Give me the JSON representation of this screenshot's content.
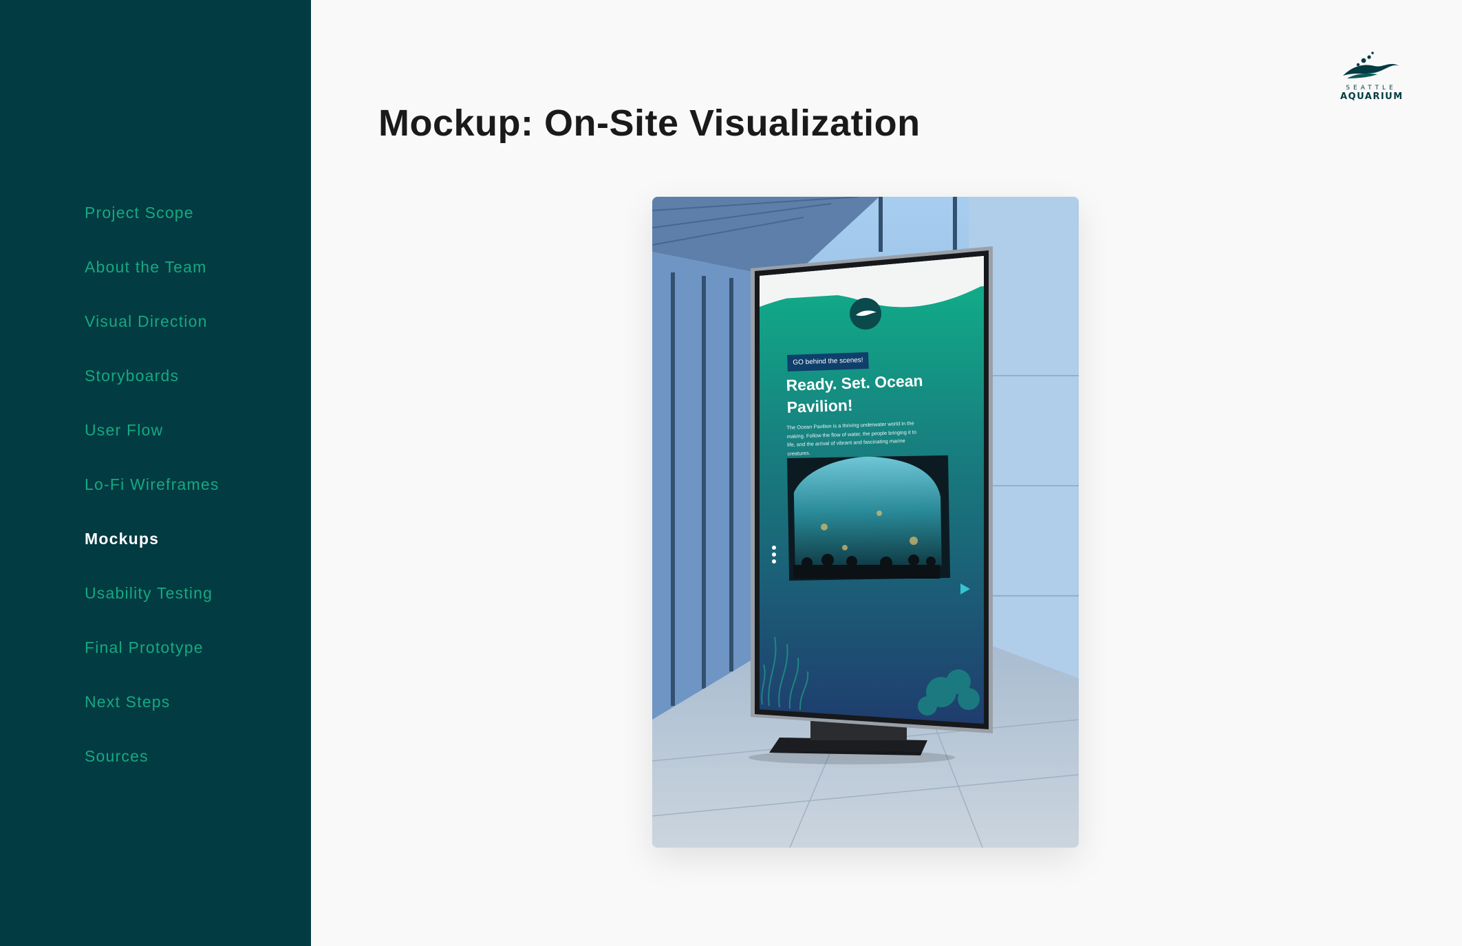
{
  "sidebar": {
    "items": [
      {
        "label": "Project Scope"
      },
      {
        "label": "About the Team"
      },
      {
        "label": "Visual Direction"
      },
      {
        "label": "Storyboards"
      },
      {
        "label": "User Flow"
      },
      {
        "label": "Lo-Fi Wireframes"
      },
      {
        "label": "Mockups",
        "active": true
      },
      {
        "label": "Usability Testing"
      },
      {
        "label": "Final Prototype"
      },
      {
        "label": "Next Steps"
      },
      {
        "label": "Sources"
      }
    ]
  },
  "header": {
    "title": "Mockup: On-Site Visualization",
    "logo": {
      "line1": "SEATTLE",
      "line2": "AQUARIUM",
      "icon": "wave-logo-icon"
    }
  },
  "mockup": {
    "badge": "GO behind the scenes!",
    "headline": "Ready. Set. Ocean Pavilion!",
    "body": "The Ocean Pavilion is a thriving underwater world in the making. Follow the flow of water, the people bringing it to life, and the arrival of vibrant and fascinating marine creatures."
  },
  "colors": {
    "sidebar_bg": "#033b42",
    "nav_link": "#15a982",
    "nav_active": "#ffffff",
    "accent_green": "#0fb389",
    "navy": "#1c3d70"
  }
}
